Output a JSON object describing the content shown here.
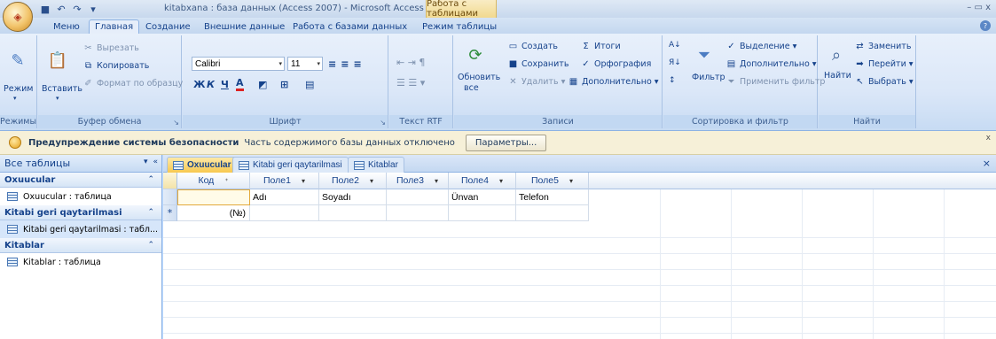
{
  "window": {
    "title": "kitabxana : база данных (Access 2007) - Microsoft Access",
    "context_tab_title": "Работа с таблицами",
    "controls": "– ▭ x"
  },
  "ribbon_tabs": [
    {
      "label": "Меню"
    },
    {
      "label": "Главная"
    },
    {
      "label": "Создание"
    },
    {
      "label": "Внешние данные"
    },
    {
      "label": "Работа с базами данных"
    },
    {
      "label": "Режим таблицы"
    }
  ],
  "ribbon": {
    "modes": {
      "label": "Режимы",
      "view": "Режим"
    },
    "clipboard": {
      "label": "Буфер обмена",
      "paste": "Вставить",
      "cut": "Вырезать",
      "copy": "Копировать",
      "format_painter": "Формат по образцу"
    },
    "font": {
      "label": "Шрифт",
      "font_name": "Calibri",
      "font_size": "11",
      "bold": "Ж",
      "italic": "К",
      "underline": "Ч",
      "text_color": "A"
    },
    "rtf": {
      "label": "Текст RTF"
    },
    "records": {
      "label": "Записи",
      "refresh": "Обновить",
      "refresh_sub": "все",
      "new": "Создать",
      "save": "Сохранить",
      "delete": "Удалить",
      "totals": "Итоги",
      "spelling": "Орфография",
      "more": "Дополнительно"
    },
    "sort_filter": {
      "label": "Сортировка и фильтр",
      "filter": "Фильтр",
      "selection": "Выделение",
      "advanced": "Дополнительно",
      "toggle_filter": "Применить фильтр"
    },
    "find": {
      "label": "Найти",
      "find": "Найти",
      "replace": "Заменить",
      "goto": "Перейти",
      "select": "Выбрать"
    }
  },
  "security_bar": {
    "title": "Предупреждение системы безопасности",
    "message": "Часть содержимого базы данных отключено",
    "button": "Параметры...",
    "close": "x"
  },
  "nav_pane": {
    "header": "Все таблицы",
    "groups": [
      {
        "name": "Oxuucular",
        "items": [
          "Oxuucular : таблица"
        ]
      },
      {
        "name": "Kitabi geri qaytarilmasi",
        "items": [
          "Kitabi geri qaytarilmasi : табл..."
        ]
      },
      {
        "name": "Kitablar",
        "items": [
          "Kitablar : таблица"
        ]
      }
    ]
  },
  "doc_tabs": [
    {
      "label": "Oxuucular",
      "active": true
    },
    {
      "label": "Kitabi geri qaytarilmasi",
      "active": false
    },
    {
      "label": "Kitablar",
      "active": false
    }
  ],
  "grid": {
    "columns": [
      "Код",
      "Поле1",
      "Поле2",
      "Поле3",
      "Поле4",
      "Поле5"
    ],
    "rows": [
      [
        "",
        "Adı",
        "Soyadı",
        "",
        "Ünvan",
        "Telefon"
      ],
      [
        "(№)",
        "",
        "",
        "",
        "",
        ""
      ]
    ],
    "new_row_marker": "*"
  }
}
